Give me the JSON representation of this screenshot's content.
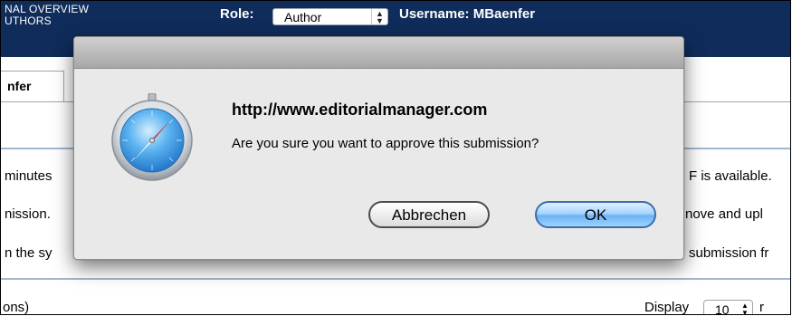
{
  "header": {
    "journal_line1": "NAL OVERVIEW",
    "journal_line2": "UTHORS",
    "role_label": "Role:",
    "role_value": "Author",
    "username": "Username: MBaenfer"
  },
  "tab": {
    "label": "nfer"
  },
  "background_text": {
    "row1_left": "minutes",
    "row1_right": "F is available.",
    "row2_left": "nission.",
    "row2_right": "nove and upl",
    "row3_left": "n the sy",
    "row3_right": "submission fr",
    "footer_left": "ons)",
    "display_label": "Display",
    "display_value": "10",
    "display_tail": "r"
  },
  "dialog": {
    "heading": "http://www.editorialmanager.com",
    "message": "Are you sure you want to approve this submission?",
    "cancel_label": "Abbrechen",
    "ok_label": "OK",
    "icon": "safari-compass-icon"
  },
  "colors": {
    "header_bg": "#0f2c5a",
    "dialog_bg": "#e9e9e9",
    "ok_button": "#6bb3f3"
  }
}
